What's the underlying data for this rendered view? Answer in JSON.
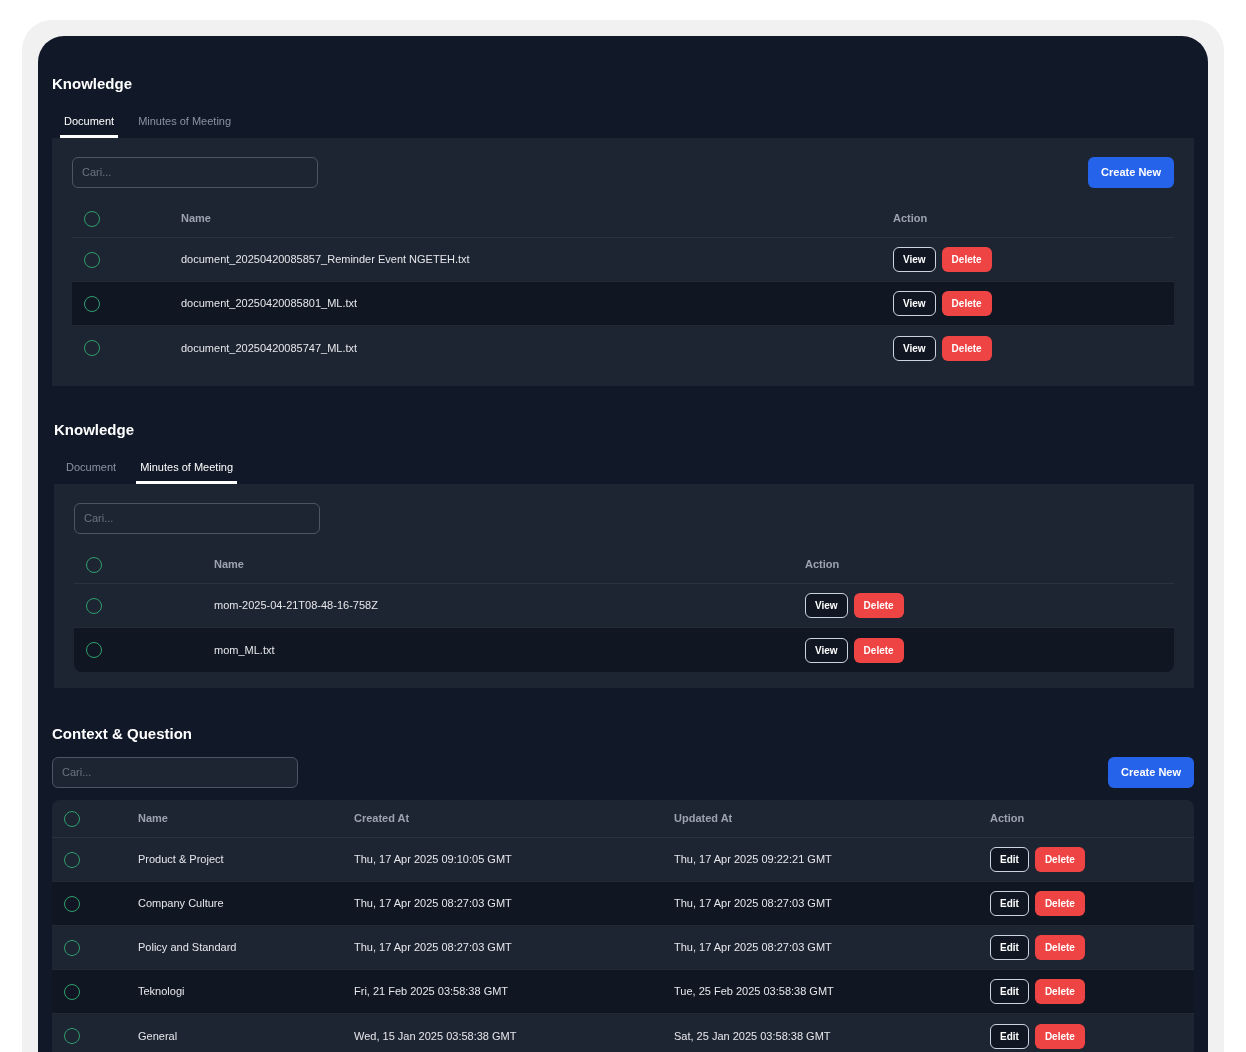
{
  "sections": [
    {
      "kind": "tabbed",
      "title": "Knowledge",
      "tabs": [
        {
          "label": "Document",
          "selected": true
        },
        {
          "label": "Minutes of Meeting",
          "selected": false
        }
      ],
      "search": {
        "placeholder": "Cari..."
      },
      "create_button": "Create New",
      "table": {
        "columns": [
          "Name",
          "Action"
        ],
        "rows": [
          {
            "checked": false,
            "cells": [
              "document_20250420085857_Reminder Event NGETEH.txt"
            ],
            "actions": [
              "View",
              "Delete"
            ]
          },
          {
            "checked": false,
            "cells": [
              "document_20250420085801_ML.txt"
            ],
            "actions": [
              "View",
              "Delete"
            ]
          },
          {
            "checked": false,
            "cells": [
              "document_20250420085747_ML.txt"
            ],
            "actions": [
              "View",
              "Delete"
            ]
          }
        ]
      },
      "header_checked": false
    },
    {
      "kind": "tabbed",
      "title": "Knowledge",
      "tabs": [
        {
          "label": "Document",
          "selected": false
        },
        {
          "label": "Minutes of Meeting",
          "selected": true
        }
      ],
      "search": {
        "placeholder": "Cari..."
      },
      "table": {
        "columns": [
          "Name",
          "Action"
        ],
        "rows": [
          {
            "checked": false,
            "cells": [
              "mom-2025-04-21T08-48-16-758Z"
            ],
            "actions": [
              "View",
              "Delete"
            ]
          },
          {
            "checked": false,
            "cells": [
              "mom_ML.txt"
            ],
            "actions": [
              "View",
              "Delete"
            ]
          }
        ]
      },
      "header_checked": false
    },
    {
      "kind": "plain",
      "title": "Context & Question",
      "search": {
        "placeholder": "Cari..."
      },
      "create_button": "Create New",
      "table": {
        "columns": [
          "Name",
          "Created At",
          "Updated At",
          "Action"
        ],
        "rows": [
          {
            "checked": false,
            "cells": [
              "Product & Project",
              "Thu, 17 Apr 2025 09:10:05 GMT",
              "Thu, 17 Apr 2025 09:22:21 GMT"
            ],
            "actions": [
              "Edit",
              "Delete"
            ]
          },
          {
            "checked": false,
            "cells": [
              "Company Culture",
              "Thu, 17 Apr 2025 08:27:03 GMT",
              "Thu, 17 Apr 2025 08:27:03 GMT"
            ],
            "actions": [
              "Edit",
              "Delete"
            ]
          },
          {
            "checked": false,
            "cells": [
              "Policy and Standard",
              "Thu, 17 Apr 2025 08:27:03 GMT",
              "Thu, 17 Apr 2025 08:27:03 GMT"
            ],
            "actions": [
              "Edit",
              "Delete"
            ]
          },
          {
            "checked": false,
            "cells": [
              "Teknologi",
              "Fri, 21 Feb 2025 03:58:38 GMT",
              "Tue, 25 Feb 2025 03:58:38 GMT"
            ],
            "actions": [
              "Edit",
              "Delete"
            ]
          },
          {
            "checked": false,
            "cells": [
              "General",
              "Wed, 15 Jan 2025 03:58:38 GMT",
              "Sat, 25 Jan 2025 03:58:38 GMT"
            ],
            "actions": [
              "Edit",
              "Delete"
            ]
          }
        ]
      },
      "header_checked": false
    }
  ]
}
